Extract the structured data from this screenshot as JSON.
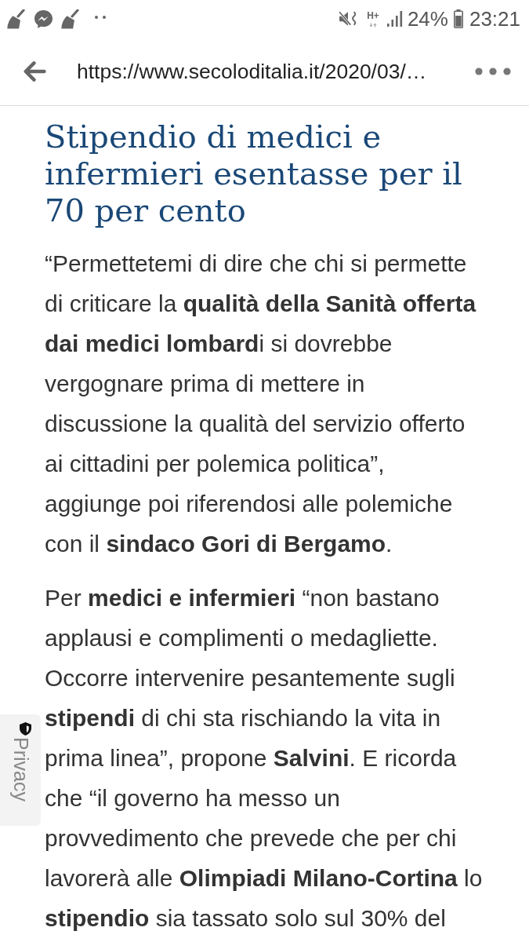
{
  "status_bar": {
    "network_type": "H+",
    "battery": "24%",
    "time": "23:21"
  },
  "browser": {
    "url": "https://www.secoloditalia.it/2020/03/…"
  },
  "article": {
    "title": "Stipendio di medici e infermieri esentasse per il 70 per cento",
    "paragraphs": [
      "“Permettetemi di dire che chi si permette di criticare la **qualità della Sanità offerta dai medici lombard**i si dovrebbe vergognare prima di mettere in discussione la qualità del servizio offerto ai cittadini per polemica politica”, aggiunge poi riferendosi alle polemiche con il **sindaco Gori di Bergamo**.",
      "Per **medici e infermieri** “non bastano applausi e complimenti o medagliette. Occorre intervenire pesantemente sugli **stipendi** di chi sta rischiando la vita in prima linea”, propone **Salvini**. E ricorda che “il governo ha messo un provvedimento che prevede che per chi lavorerà alle **Olimpiadi Milano-Cortina** lo **stipendio** sia tassato solo sul 30% del"
    ]
  },
  "privacy_tab": {
    "label": "Privacy"
  }
}
